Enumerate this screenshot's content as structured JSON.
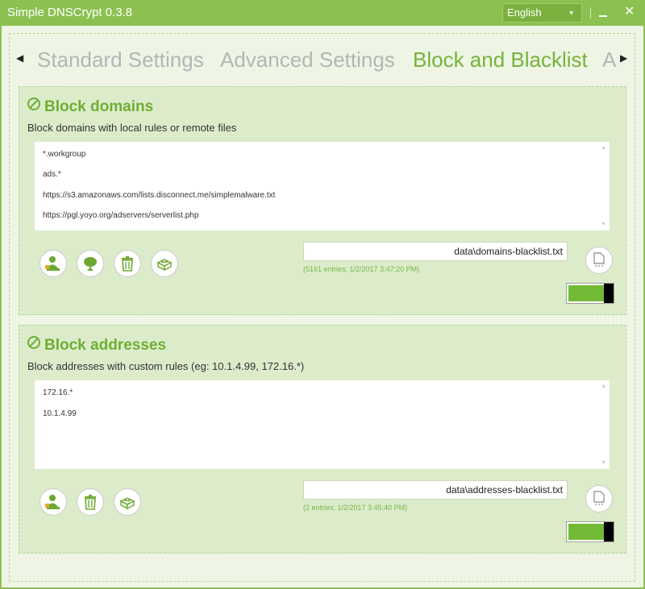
{
  "window": {
    "title": "Simple DNSCrypt 0.3.8",
    "language": "English"
  },
  "tabs": [
    {
      "label": "Standard Settings"
    },
    {
      "label": "Advanced Settings"
    },
    {
      "label": "Block and Blacklist"
    },
    {
      "label": "A"
    }
  ],
  "domains": {
    "title": "Block domains",
    "description": "Block domains with local rules or remote files",
    "rules": [
      "*.workgroup",
      "ads.*",
      "https://s3.amazonaws.com/lists.disconnect.me/simplemalware.txt",
      "https://pgl.yoyo.org/adservers/serverlist.php"
    ],
    "file": "data\\domains-blacklist.txt",
    "meta": "(5161 entries; 1/2/2017 3:47:20 PM)",
    "enabled": true
  },
  "addresses": {
    "title": "Block addresses",
    "description": "Block addresses with custom rules (eg: 10.1.4.99, 172.16.*)",
    "rules": [
      "172.16.*",
      "10.1.4.99"
    ],
    "file": "data\\addresses-blacklist.txt",
    "meta": "(2 entries; 1/2/2017 3:45:40 PM)",
    "enabled": true
  },
  "colors": {
    "accent": "#8cc152",
    "active_tab": "#76b33c",
    "toggle_on": "#72b936"
  }
}
